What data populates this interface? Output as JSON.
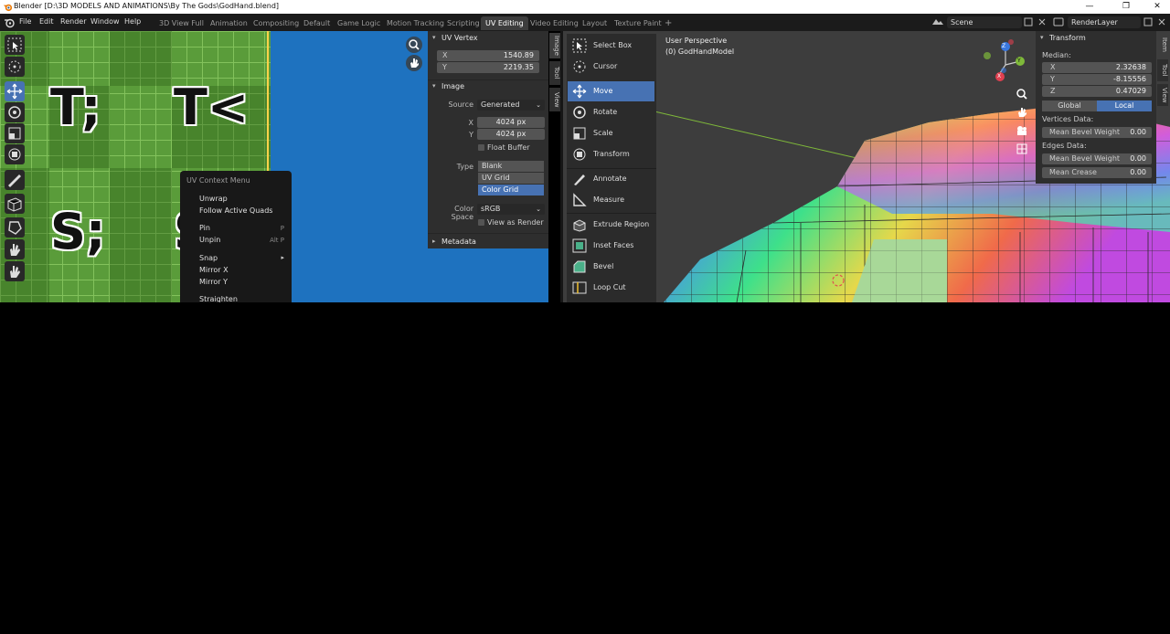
{
  "window": {
    "title": "Blender [D:\\3D MODELS AND ANIMATIONS\\By The Gods\\GodHand.blend]",
    "minimize": "—",
    "maximize": "❐",
    "close": "✕"
  },
  "menubar": {
    "menus": [
      "File",
      "Edit",
      "Render",
      "Window",
      "Help"
    ],
    "workspaces": [
      "3D View Full",
      "Animation",
      "Compositing",
      "Default",
      "Game Logic",
      "Motion Tracking",
      "Scripting",
      "UV Editing",
      "Video Editing",
      "Layout",
      "Texture Paint"
    ],
    "active_workspace": "UV Editing",
    "add_tab": "+",
    "scene": "Scene",
    "render_layer": "RenderLayer"
  },
  "uv_editor": {
    "glyphs": [
      "T;",
      "T<",
      "S;",
      "S<"
    ],
    "context_menu": {
      "title": "UV Context Menu",
      "items": [
        {
          "label": "Unwrap",
          "shortcut": ""
        },
        {
          "label": "Follow Active Quads",
          "shortcut": ""
        },
        {
          "label": "Pin",
          "shortcut": "P"
        },
        {
          "label": "Unpin",
          "shortcut": "Alt P"
        },
        {
          "label": "Snap",
          "shortcut": "▸"
        },
        {
          "label": "Mirror X",
          "shortcut": ""
        },
        {
          "label": "Mirror Y",
          "shortcut": ""
        },
        {
          "label": "Straighten",
          "shortcut": ""
        }
      ]
    },
    "sidebar": {
      "uv_vertex": {
        "header": "UV Vertex",
        "x_label": "X",
        "x_value": "1540.89",
        "y_label": "Y",
        "y_value": "2219.35"
      },
      "image": {
        "header": "Image",
        "source_label": "Source",
        "source_value": "Generated",
        "x_label": "X",
        "x_value": "4024 px",
        "y_label": "Y",
        "y_value": "4024 px",
        "float_buffer": "Float Buffer",
        "type_label": "Type",
        "types": [
          "Blank",
          "UV Grid",
          "Color Grid"
        ],
        "selected_type": "Color Grid",
        "color_space_label": "Color Space",
        "color_space_value": "sRGB",
        "view_as_render": "View as Render"
      },
      "metadata": {
        "header": "Metadata"
      },
      "tabs": [
        "Image",
        "Tool",
        "View"
      ]
    }
  },
  "viewport": {
    "perspective": "User Perspective",
    "object": "(0) GodHandModel",
    "gizmo_labels": {
      "x": "X",
      "y": "Y",
      "z": "Z"
    },
    "toolshelf": [
      {
        "label": "Select Box",
        "icon": "select-box-icon"
      },
      {
        "label": "Cursor",
        "icon": "cursor-icon"
      },
      {
        "label": "Move",
        "icon": "move-icon"
      },
      {
        "label": "Rotate",
        "icon": "rotate-icon"
      },
      {
        "label": "Scale",
        "icon": "scale-icon"
      },
      {
        "label": "Transform",
        "icon": "transform-icon"
      },
      {
        "label": "Annotate",
        "icon": "annotate-icon"
      },
      {
        "label": "Measure",
        "icon": "measure-icon"
      },
      {
        "label": "Extrude Region",
        "icon": "extrude-region-icon"
      },
      {
        "label": "Inset Faces",
        "icon": "inset-faces-icon"
      },
      {
        "label": "Bevel",
        "icon": "bevel-icon"
      },
      {
        "label": "Loop Cut",
        "icon": "loop-cut-icon"
      }
    ],
    "active_tool": "Move",
    "transform": {
      "header": "Transform",
      "median_label": "Median:",
      "x_label": "X",
      "x_value": "2.32638",
      "y_label": "Y",
      "y_value": "-8.15556",
      "z_label": "Z",
      "z_value": "0.47029",
      "global": "Global",
      "local": "Local",
      "vertices_data": "Vertices Data:",
      "mean_bevel_weight_v": "Mean Bevel Weight",
      "mean_bevel_weight_v_value": "0.00",
      "edges_data": "Edges Data:",
      "mean_bevel_weight_e": "Mean Bevel Weight",
      "mean_bevel_weight_e_value": "0.00",
      "mean_crease": "Mean Crease",
      "mean_crease_value": "0.00"
    },
    "tabs": [
      "Item",
      "Tool",
      "View"
    ]
  },
  "colors": {
    "accent": "#4772b3",
    "uv_background": "#1e72bf",
    "grid_green": "#5a9c3a",
    "viewport_bg": "#3d3d3d"
  }
}
